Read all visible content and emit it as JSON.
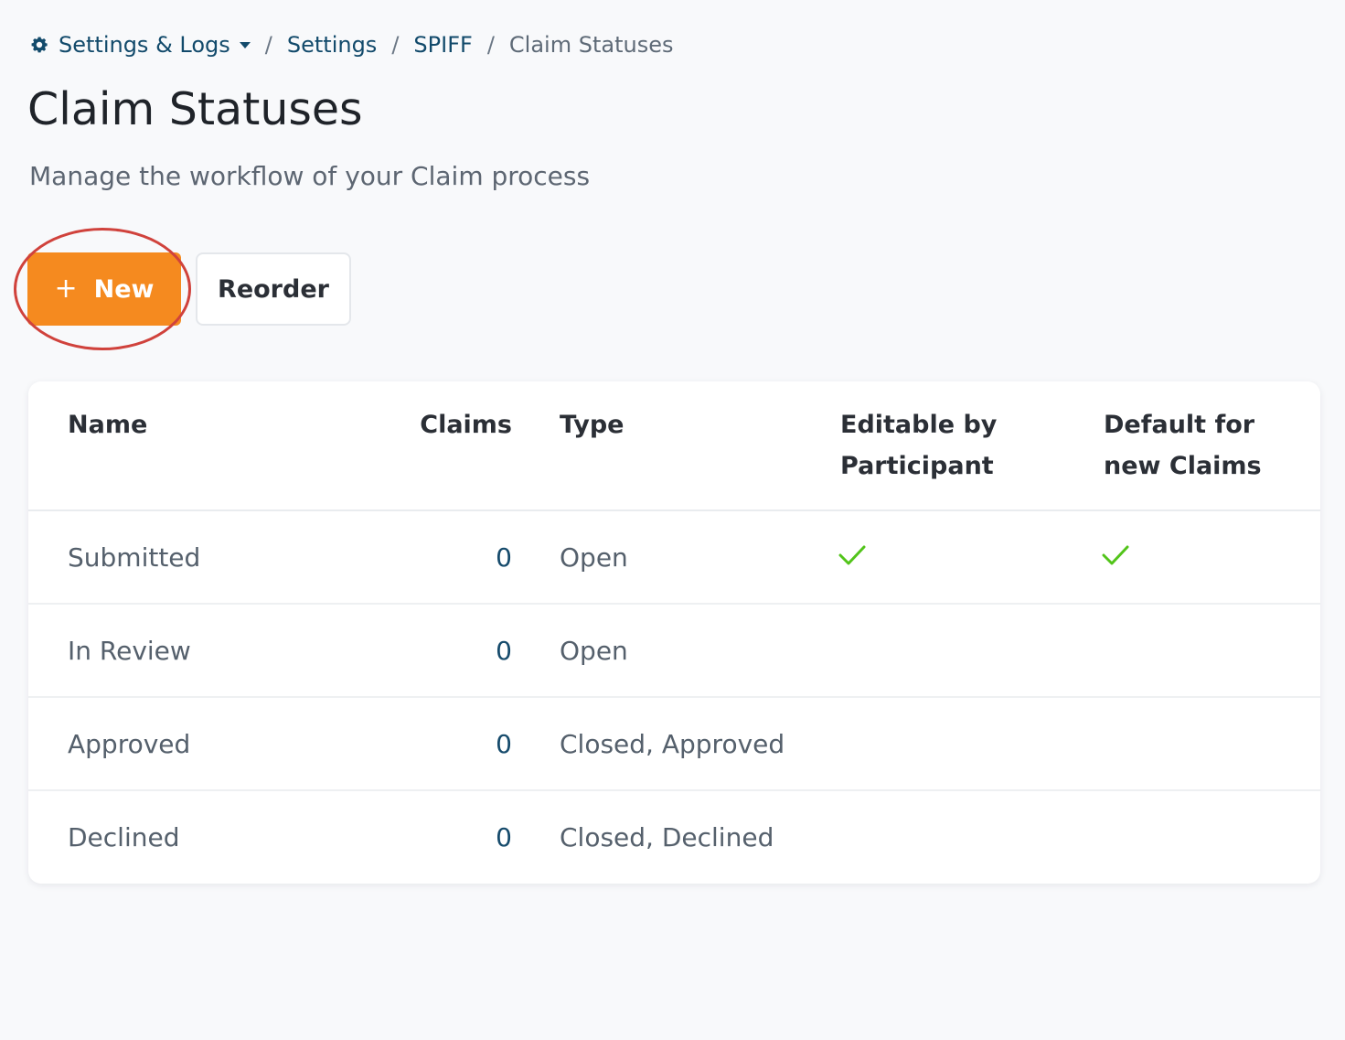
{
  "breadcrumb": {
    "items": [
      "Settings & Logs",
      "Settings",
      "SPIFF"
    ],
    "current": "Claim Statuses",
    "separator": "/"
  },
  "page": {
    "title": "Claim Statuses",
    "subtitle": "Manage the workflow of your Claim process"
  },
  "actions": {
    "new_label": "New",
    "new_icon": "+",
    "reorder_label": "Reorder"
  },
  "table": {
    "headers": {
      "name": "Name",
      "claims": "Claims",
      "type": "Type",
      "editable": "Editable by Participant",
      "default": "Default for new Claims"
    },
    "rows": [
      {
        "name": "Submitted",
        "claims": "0",
        "type": "Open",
        "editable": true,
        "default": true
      },
      {
        "name": "In Review",
        "claims": "0",
        "type": "Open",
        "editable": false,
        "default": false
      },
      {
        "name": "Approved",
        "claims": "0",
        "type": "Closed, Approved",
        "editable": false,
        "default": false
      },
      {
        "name": "Declined",
        "claims": "0",
        "type": "Closed, Declined",
        "editable": false,
        "default": false
      }
    ]
  },
  "colors": {
    "accent": "#f58a1f",
    "link": "#124a6b",
    "check": "#52c41a",
    "highlight": "#d0423c"
  }
}
